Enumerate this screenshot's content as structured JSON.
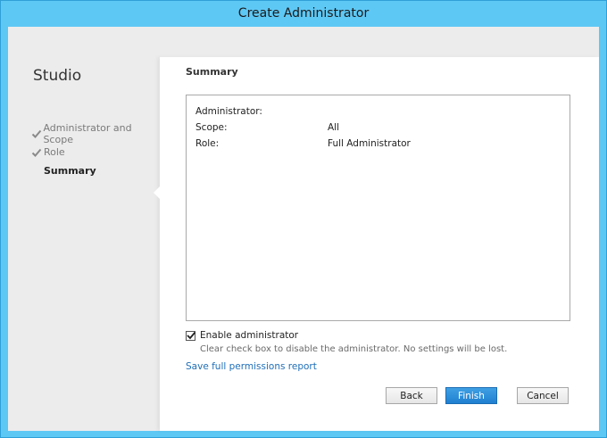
{
  "window": {
    "title": "Create Administrator"
  },
  "sidebar": {
    "product": "Studio",
    "steps": [
      {
        "label": "Administrator and Scope",
        "done": true
      },
      {
        "label": "Role",
        "done": true
      },
      {
        "label": "Summary",
        "done": false,
        "current": true
      }
    ]
  },
  "main": {
    "section_title": "Summary",
    "summary": [
      {
        "key": "Administrator:",
        "value": ""
      },
      {
        "key": "Scope:",
        "value": "All"
      },
      {
        "key": "Role:",
        "value": "Full Administrator"
      }
    ],
    "enable_checkbox": {
      "label": "Enable administrator",
      "checked": true,
      "help": "Clear check box to disable the administrator. No settings will be lost."
    },
    "report_link": "Save full permissions report"
  },
  "buttons": {
    "back": "Back",
    "finish": "Finish",
    "cancel": "Cancel"
  },
  "icons": {
    "step_done": "checkmark-icon",
    "checkbox": "checkbox-checked-icon"
  },
  "colors": {
    "window_frame": "#5ec8f5",
    "link": "#1f6fb8",
    "primary_button": "#2a8ad8"
  }
}
